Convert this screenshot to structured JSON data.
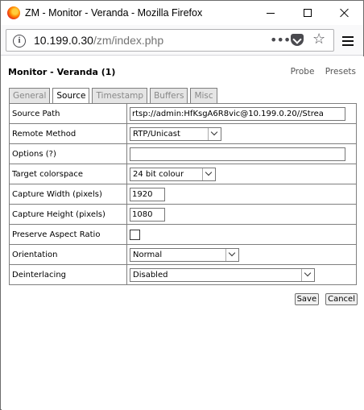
{
  "window": {
    "title": "ZM - Monitor - Veranda - Mozilla Firefox"
  },
  "navbar": {
    "url_host": "10.199.0.30",
    "url_path": "/zm/index.php",
    "page_actions_icon": "dots-icon",
    "pocket_icon": "pocket-icon",
    "bookmark_icon": "star-icon",
    "menu_icon": "hamburger-menu-icon"
  },
  "page": {
    "title": "Monitor - Veranda (1)",
    "links": {
      "probe": "Probe",
      "presets": "Presets"
    },
    "tabs": [
      {
        "label": "General",
        "active": false
      },
      {
        "label": "Source",
        "active": true
      },
      {
        "label": "Timestamp",
        "active": false
      },
      {
        "label": "Buffers",
        "active": false
      },
      {
        "label": "Misc",
        "active": false
      }
    ],
    "fields": {
      "source_path": {
        "label": "Source Path",
        "value": "rtsp://admin:HfKsgA6R8vic@10.199.0.20//Strea"
      },
      "remote_method": {
        "label": "Remote Method",
        "value": "RTP/Unicast"
      },
      "options": {
        "label": "Options (?)",
        "value": ""
      },
      "target_colorspace": {
        "label": "Target colorspace",
        "value": "24 bit colour"
      },
      "capture_width": {
        "label": "Capture Width (pixels)",
        "value": "1920"
      },
      "capture_height": {
        "label": "Capture Height (pixels)",
        "value": "1080"
      },
      "preserve_aspect": {
        "label": "Preserve Aspect Ratio",
        "checked": false
      },
      "orientation": {
        "label": "Orientation",
        "value": "Normal"
      },
      "deinterlacing": {
        "label": "Deinterlacing",
        "value": "Disabled"
      }
    },
    "buttons": {
      "save": "Save",
      "cancel": "Cancel"
    }
  }
}
